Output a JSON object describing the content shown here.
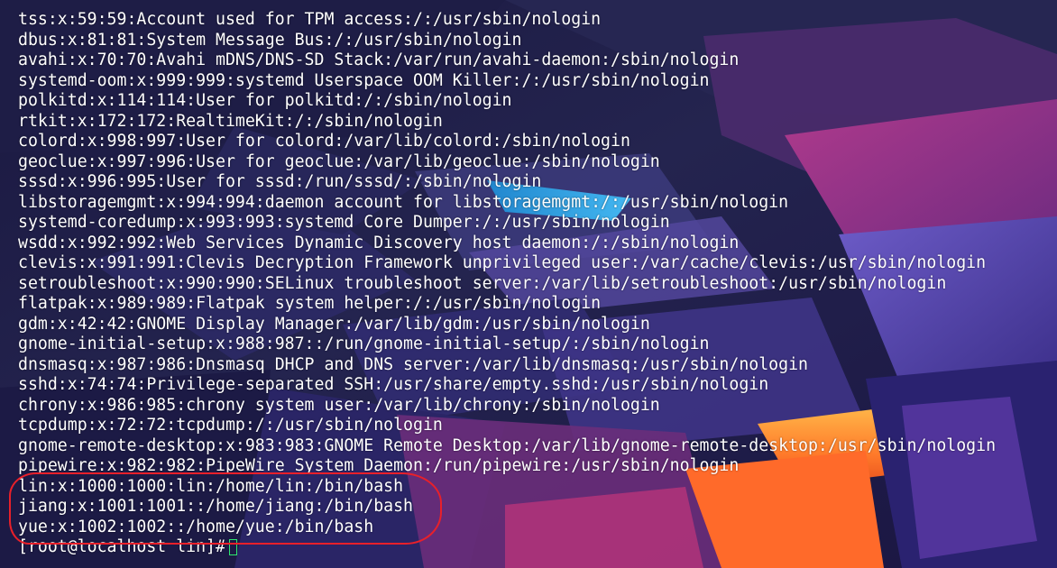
{
  "terminal": {
    "lines": [
      "tss:x:59:59:Account used for TPM access:/:/usr/sbin/nologin",
      "dbus:x:81:81:System Message Bus:/:/usr/sbin/nologin",
      "avahi:x:70:70:Avahi mDNS/DNS-SD Stack:/var/run/avahi-daemon:/sbin/nologin",
      "systemd-oom:x:999:999:systemd Userspace OOM Killer:/:/usr/sbin/nologin",
      "polkitd:x:114:114:User for polkitd:/:/sbin/nologin",
      "rtkit:x:172:172:RealtimeKit:/:/sbin/nologin",
      "colord:x:998:997:User for colord:/var/lib/colord:/sbin/nologin",
      "geoclue:x:997:996:User for geoclue:/var/lib/geoclue:/sbin/nologin",
      "sssd:x:996:995:User for sssd:/run/sssd/:/sbin/nologin",
      "libstoragemgmt:x:994:994:daemon account for libstoragemgmt:/:/usr/sbin/nologin",
      "systemd-coredump:x:993:993:systemd Core Dumper:/:/usr/sbin/nologin",
      "wsdd:x:992:992:Web Services Dynamic Discovery host daemon:/:/sbin/nologin",
      "clevis:x:991:991:Clevis Decryption Framework unprivileged user:/var/cache/clevis:/usr/sbin/nologin",
      "setroubleshoot:x:990:990:SELinux troubleshoot server:/var/lib/setroubleshoot:/usr/sbin/nologin",
      "flatpak:x:989:989:Flatpak system helper:/:/usr/sbin/nologin",
      "gdm:x:42:42:GNOME Display Manager:/var/lib/gdm:/usr/sbin/nologin",
      "gnome-initial-setup:x:988:987::/run/gnome-initial-setup/:/sbin/nologin",
      "dnsmasq:x:987:986:Dnsmasq DHCP and DNS server:/var/lib/dnsmasq:/usr/sbin/nologin",
      "sshd:x:74:74:Privilege-separated SSH:/usr/share/empty.sshd:/usr/sbin/nologin",
      "chrony:x:986:985:chrony system user:/var/lib/chrony:/sbin/nologin",
      "tcpdump:x:72:72:tcpdump:/:/usr/sbin/nologin",
      "gnome-remote-desktop:x:983:983:GNOME Remote Desktop:/var/lib/gnome-remote-desktop:/usr/sbin/nologin",
      "pipewire:x:982:982:PipeWire System Daemon:/run/pipewire:/usr/sbin/nologin",
      "lin:x:1000:1000:lin:/home/lin:/bin/bash",
      "jiang:x:1001:1001::/home/jiang:/bin/bash",
      "yue:x:1002:1002::/home/yue:/bin/bash"
    ],
    "prompt": "[root@localhost lin]#",
    "text_color": "#ffffff",
    "cursor_color": "#2fe870"
  },
  "annotation": {
    "outline_color": "#e8202a"
  }
}
